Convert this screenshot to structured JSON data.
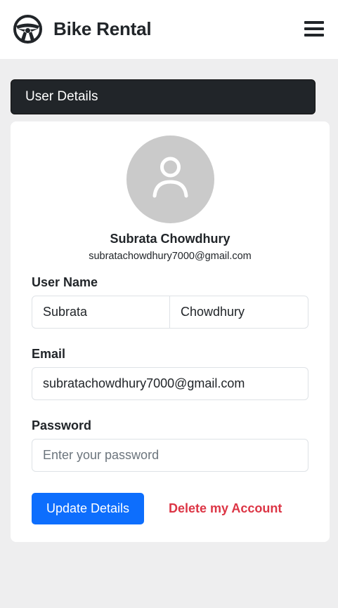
{
  "navbar": {
    "brand_name": "Bike Rental",
    "brand_icon": "steering-wheel-icon",
    "menu_icon": "hamburger-menu-icon"
  },
  "section": {
    "title": "User Details"
  },
  "profile": {
    "avatar_icon": "user-avatar-icon",
    "name": "Subrata Chowdhury",
    "email": "subratachowdhury7000@gmail.com"
  },
  "form": {
    "username_label": "User Name",
    "first_name_value": "Subrata",
    "last_name_value": "Chowdhury",
    "email_label": "Email",
    "email_value": "subratachowdhury7000@gmail.com",
    "password_label": "Password",
    "password_placeholder": "Enter your password",
    "password_value": ""
  },
  "actions": {
    "update_label": "Update Details",
    "delete_label": "Delete my Account"
  },
  "colors": {
    "primary": "#0d6efd",
    "danger": "#dc3545",
    "dark": "#212529",
    "page_bg": "#eeeeef"
  }
}
